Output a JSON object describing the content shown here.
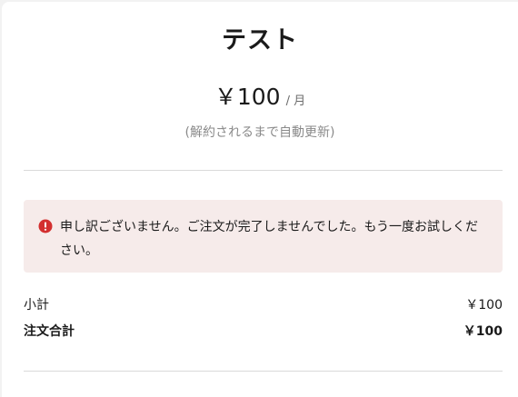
{
  "plan": {
    "title": "テスト",
    "price": "￥100",
    "period": "/ 月",
    "renewal_note": "(解約されるまで自動更新)"
  },
  "error": {
    "icon": "alert-circle-icon",
    "message": "申し訳ございません。ご注文が完了しませんでした。もう一度お試しください。",
    "color": "#d32f2f",
    "background": "#f6ebea"
  },
  "summary": {
    "subtotal_label": "小計",
    "subtotal_value": "￥100",
    "total_label": "注文合計",
    "total_value": "￥100"
  }
}
